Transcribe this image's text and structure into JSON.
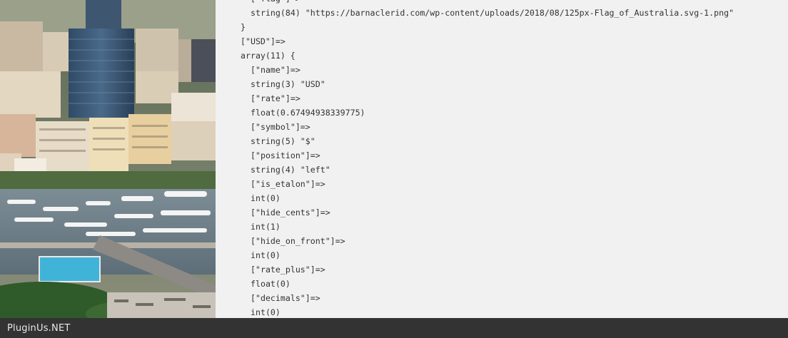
{
  "photo": {
    "subject": "monaco-harbor-photo"
  },
  "code_dump": {
    "lines": [
      {
        "indent": 1,
        "text": "[\"flag\"]=>"
      },
      {
        "indent": 1,
        "text": "string(84) \"https://barnaclerid.com/wp-content/uploads/2018/08/125px-Flag_of_Australia.svg-1.png\""
      },
      {
        "indent": 0,
        "text": "}"
      },
      {
        "indent": 0,
        "text": "[\"USD\"]=>"
      },
      {
        "indent": 0,
        "text": "array(11) {"
      },
      {
        "indent": 1,
        "text": "[\"name\"]=>"
      },
      {
        "indent": 1,
        "text": "string(3) \"USD\""
      },
      {
        "indent": 1,
        "text": "[\"rate\"]=>"
      },
      {
        "indent": 1,
        "text": "float(0.67494938339775)"
      },
      {
        "indent": 1,
        "text": "[\"symbol\"]=>"
      },
      {
        "indent": 1,
        "text": "string(5) \"$\""
      },
      {
        "indent": 1,
        "text": "[\"position\"]=>"
      },
      {
        "indent": 1,
        "text": "string(4) \"left\""
      },
      {
        "indent": 1,
        "text": "[\"is_etalon\"]=>"
      },
      {
        "indent": 1,
        "text": "int(0)"
      },
      {
        "indent": 1,
        "text": "[\"hide_cents\"]=>"
      },
      {
        "indent": 1,
        "text": "int(1)"
      },
      {
        "indent": 1,
        "text": "[\"hide_on_front\"]=>"
      },
      {
        "indent": 1,
        "text": "int(0)"
      },
      {
        "indent": 1,
        "text": "[\"rate_plus\"]=>"
      },
      {
        "indent": 1,
        "text": "float(0)"
      },
      {
        "indent": 1,
        "text": "[\"decimals\"]=>"
      },
      {
        "indent": 1,
        "text": "int(0)"
      }
    ]
  },
  "footer": {
    "brand": "PluginUs.NET"
  },
  "colors": {
    "page_bg": "#f1f1f1",
    "code_text": "#333333",
    "footer_bg": "#333333",
    "footer_text": "#e8e8e8"
  }
}
